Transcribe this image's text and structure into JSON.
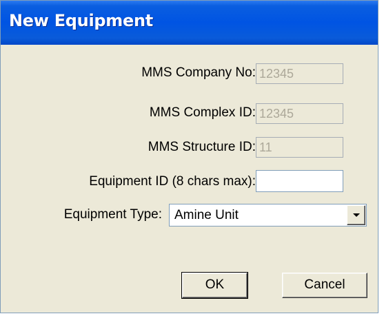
{
  "dialog": {
    "title": "New Equipment"
  },
  "form": {
    "company_no": {
      "label": "MMS Company No:",
      "value": "12345"
    },
    "complex_id": {
      "label": "MMS Complex ID:",
      "value": "12345"
    },
    "structure_id": {
      "label": "MMS Structure ID:",
      "value": "11"
    },
    "equipment_id": {
      "label": "Equipment ID (8 chars max):",
      "value": ""
    },
    "equipment_type": {
      "label": "Equipment Type:",
      "value": "Amine Unit"
    }
  },
  "buttons": {
    "ok": "OK",
    "cancel": "Cancel"
  },
  "colors": {
    "titlebar": "#0054e3",
    "dialog_bg": "#ece9d8",
    "disabled_text": "#aca899"
  },
  "icons": {
    "dropdown": "chevron-down-icon"
  }
}
